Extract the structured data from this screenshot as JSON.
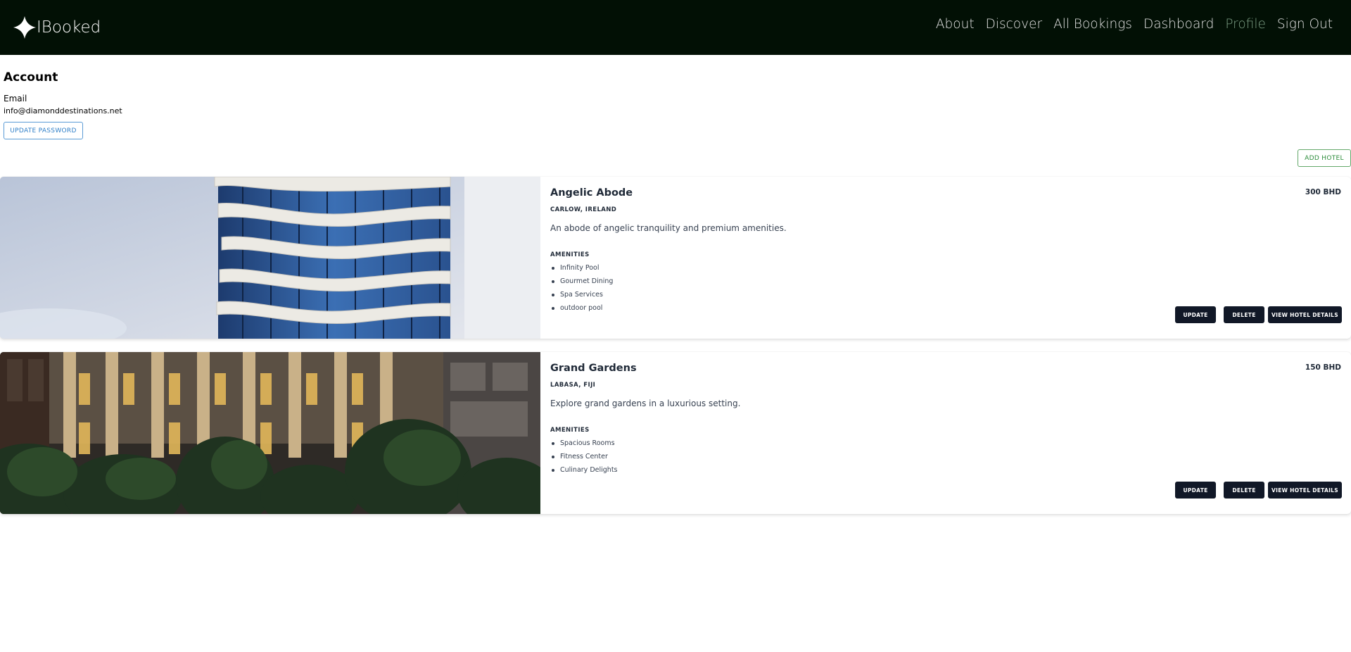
{
  "nav": {
    "brand": "IBooked",
    "links": [
      "About",
      "Discover",
      "All Bookings",
      "Dashboard",
      "Profile",
      "Sign Out"
    ],
    "active": "Profile"
  },
  "account": {
    "title": "Account",
    "email_label": "Email",
    "email": "info@diamonddestinations.net",
    "update_password": "UPDATE PASSWORD"
  },
  "add_hotel": "ADD HOTEL",
  "amenities_heading": "AMENITIES",
  "actions": {
    "update": "UPDATE",
    "delete": "DELETE",
    "view": "VIEW HOTEL DETAILS"
  },
  "hotels": [
    {
      "name": "Angelic Abode",
      "price": "300 BHD",
      "location": "CARLOW, IRELAND",
      "description": "An abode of angelic tranquility and premium amenities.",
      "amenities": [
        "Infinity Pool",
        "Gourmet Dining",
        "Spa Services",
        "outdoor pool"
      ]
    },
    {
      "name": "Grand Gardens",
      "price": "150 BHD",
      "location": "LABASA, FIJI",
      "description": "Explore grand gardens in a luxurious setting.",
      "amenities": [
        "Spacious Rooms",
        "Fitness Center",
        "Culinary Delights"
      ]
    }
  ],
  "colors": {
    "nav_bg": "#021005",
    "active_link": "#7d9f85",
    "button_dark": "#111827",
    "outline_blue": "#2f7fc8",
    "outline_green": "#2c8c3a"
  }
}
